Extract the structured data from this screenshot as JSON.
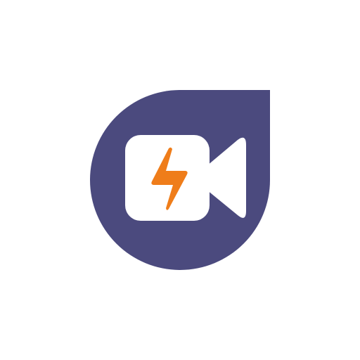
{
  "logo": {
    "icon": "video-camera-lightning-icon",
    "colors": {
      "background": "#ffffff",
      "drop": "#4b4a7e",
      "camera": "#ffffff",
      "bolt": "#ef7d1a"
    }
  }
}
